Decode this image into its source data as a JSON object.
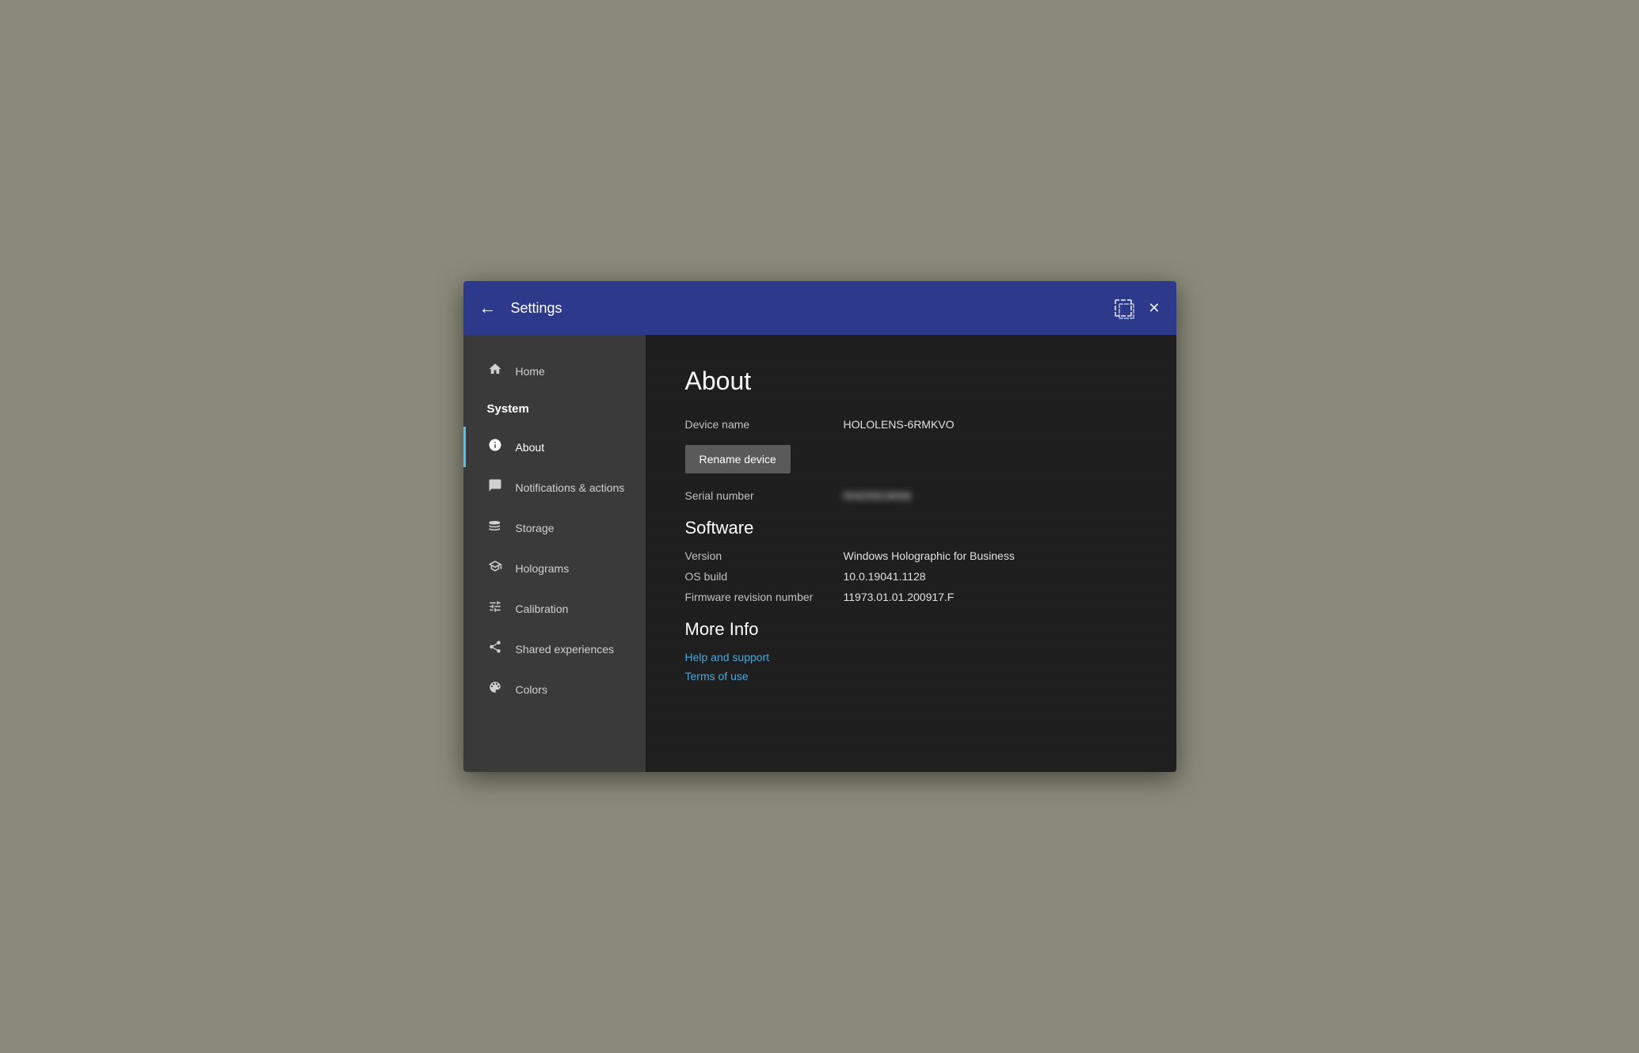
{
  "titlebar": {
    "title": "Settings",
    "back_label": "←",
    "close_label": "✕"
  },
  "sidebar": {
    "home_label": "Home",
    "system_label": "System",
    "items": [
      {
        "id": "about",
        "label": "About",
        "active": true
      },
      {
        "id": "notifications",
        "label": "Notifications & actions",
        "active": false
      },
      {
        "id": "storage",
        "label": "Storage",
        "active": false
      },
      {
        "id": "holograms",
        "label": "Holograms",
        "active": false
      },
      {
        "id": "calibration",
        "label": "Calibration",
        "active": false
      },
      {
        "id": "shared",
        "label": "Shared experiences",
        "active": false
      },
      {
        "id": "colors",
        "label": "Colors",
        "active": false
      }
    ]
  },
  "main": {
    "page_title": "About",
    "device_name_label": "Device name",
    "device_name_value": "HOLOLENS-6RMKVO",
    "rename_btn_label": "Rename device",
    "serial_number_label": "Serial number",
    "serial_number_value": "00425919006",
    "software_heading": "Software",
    "version_label": "Version",
    "version_value": "Windows Holographic for Business",
    "os_build_label": "OS build",
    "os_build_value": "10.0.19041.1128",
    "firmware_label": "Firmware revision number",
    "firmware_value": "11973.01.01.200917.F",
    "more_info_heading": "More Info",
    "help_link": "Help and support",
    "terms_link": "Terms of use"
  }
}
